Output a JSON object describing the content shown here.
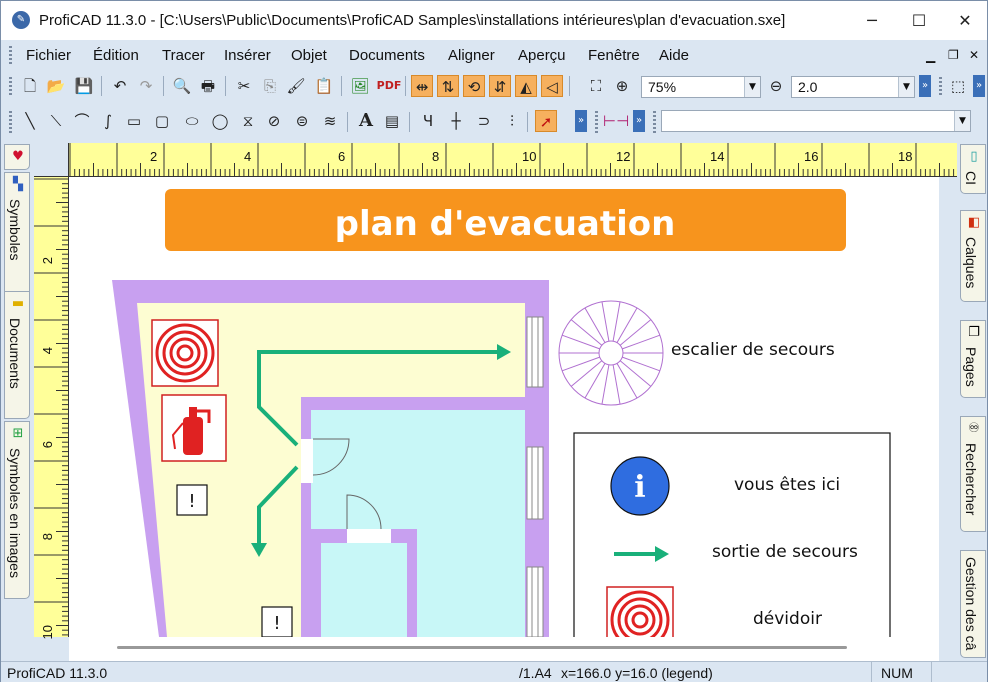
{
  "window": {
    "title": "ProfiCAD 11.3.0 - [C:\\Users\\Public\\Documents\\ProfiCAD Samples\\installations intérieures\\plan d'evacuation.sxe]",
    "minimize": "─",
    "maximize": "☐",
    "close": "✕"
  },
  "menu": {
    "items": [
      "Fichier",
      "Édition",
      "Tracer",
      "Insérer",
      "Objet",
      "Documents",
      "Aligner",
      "Aperçu",
      "Fenêtre",
      "Aide"
    ]
  },
  "toolbar": {
    "zoom_value": "75%",
    "line_width_value": "2.0",
    "pdf_label": "PDF",
    "text_tool_label": "A"
  },
  "left_tabs": [
    "Symboles",
    "Documents",
    "Symboles en images"
  ],
  "right_tabs": [
    "CI",
    "Calques",
    "Pages",
    "Rechercher",
    "Gestion des câ"
  ],
  "ruler": {
    "h_labels": [
      "2",
      "4",
      "6",
      "8",
      "10",
      "12",
      "14",
      "16",
      "18"
    ],
    "v_labels": [
      "2",
      "4",
      "6",
      "8",
      "10"
    ]
  },
  "drawing": {
    "banner_title": "plan d'evacuation",
    "stair_label": "escalier de secours",
    "legend": {
      "you_are_here": "vous êtes ici",
      "info_symbol": "i",
      "exit": "sortie de secours",
      "hose": "dévidoir"
    },
    "colors": {
      "banner": "#f7941d",
      "wall": "#c8a0f0",
      "corridor": "#fdfdd2",
      "room": "#c8f7f7",
      "arrow": "#19b07a",
      "red": "#e02222",
      "info_blue": "#2f6de0"
    }
  },
  "status": {
    "app": "ProfiCAD 11.3.0",
    "sheet": "/1.A4",
    "coords": "x=166.0  y=16.0 (legend)",
    "num": "NUM"
  }
}
